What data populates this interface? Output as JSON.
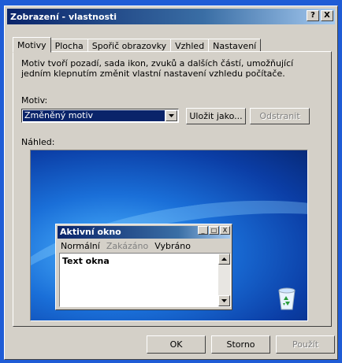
{
  "window": {
    "title": "Zobrazení - vlastnosti",
    "help_btn": "?",
    "close_btn": "X"
  },
  "tabs": [
    {
      "label": "Motivy",
      "active": true
    },
    {
      "label": "Plocha",
      "active": false
    },
    {
      "label": "Spořič obrazovky",
      "active": false
    },
    {
      "label": "Vzhled",
      "active": false
    },
    {
      "label": "Nastavení",
      "active": false
    }
  ],
  "theme_panel": {
    "description": "Motiv tvoří pozadí, sada ikon, zvuků a dalších částí, umožňující jedním klepnutím změnit vlastní nastavení vzhledu počítače.",
    "motif_label": "Motiv:",
    "motif_value": "Změněný motiv",
    "save_as_label": "Uložit jako...",
    "delete_label": "Odstranit",
    "preview_label": "Náhled:"
  },
  "preview": {
    "window_title": "Aktivní okno",
    "min_btn": "_",
    "max_btn": "□",
    "close_btn": "X",
    "menu": {
      "normal": "Normální",
      "disabled": "Zakázáno",
      "selected": "Vybráno"
    },
    "text": "Text okna",
    "recycle_icon": "recycle-bin-icon"
  },
  "footer": {
    "ok_label": "OK",
    "cancel_label": "Storno",
    "apply_label": "Použít"
  },
  "colors": {
    "titlebar_start": "#0a246a",
    "titlebar_end": "#a6caf0",
    "face": "#d4d0c8",
    "desktop_background": "#1f5cd6"
  }
}
